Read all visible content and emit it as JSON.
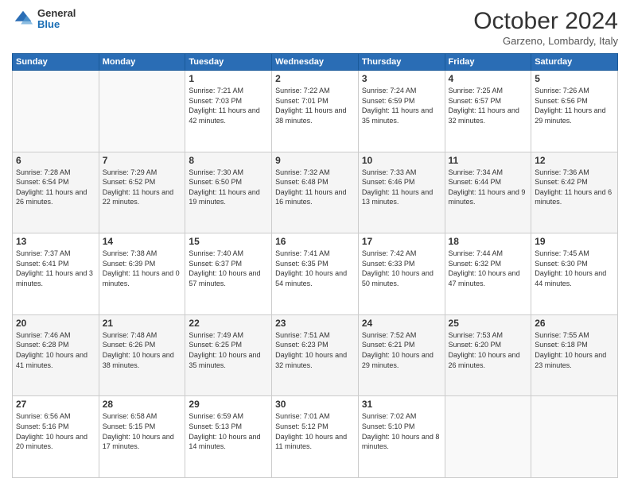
{
  "header": {
    "logo_general": "General",
    "logo_blue": "Blue",
    "month_title": "October 2024",
    "location": "Garzeno, Lombardy, Italy"
  },
  "weekdays": [
    "Sunday",
    "Monday",
    "Tuesday",
    "Wednesday",
    "Thursday",
    "Friday",
    "Saturday"
  ],
  "weeks": [
    [
      {
        "day": "",
        "sunrise": "",
        "sunset": "",
        "daylight": ""
      },
      {
        "day": "",
        "sunrise": "",
        "sunset": "",
        "daylight": ""
      },
      {
        "day": "1",
        "sunrise": "Sunrise: 7:21 AM",
        "sunset": "Sunset: 7:03 PM",
        "daylight": "Daylight: 11 hours and 42 minutes."
      },
      {
        "day": "2",
        "sunrise": "Sunrise: 7:22 AM",
        "sunset": "Sunset: 7:01 PM",
        "daylight": "Daylight: 11 hours and 38 minutes."
      },
      {
        "day": "3",
        "sunrise": "Sunrise: 7:24 AM",
        "sunset": "Sunset: 6:59 PM",
        "daylight": "Daylight: 11 hours and 35 minutes."
      },
      {
        "day": "4",
        "sunrise": "Sunrise: 7:25 AM",
        "sunset": "Sunset: 6:57 PM",
        "daylight": "Daylight: 11 hours and 32 minutes."
      },
      {
        "day": "5",
        "sunrise": "Sunrise: 7:26 AM",
        "sunset": "Sunset: 6:56 PM",
        "daylight": "Daylight: 11 hours and 29 minutes."
      }
    ],
    [
      {
        "day": "6",
        "sunrise": "Sunrise: 7:28 AM",
        "sunset": "Sunset: 6:54 PM",
        "daylight": "Daylight: 11 hours and 26 minutes."
      },
      {
        "day": "7",
        "sunrise": "Sunrise: 7:29 AM",
        "sunset": "Sunset: 6:52 PM",
        "daylight": "Daylight: 11 hours and 22 minutes."
      },
      {
        "day": "8",
        "sunrise": "Sunrise: 7:30 AM",
        "sunset": "Sunset: 6:50 PM",
        "daylight": "Daylight: 11 hours and 19 minutes."
      },
      {
        "day": "9",
        "sunrise": "Sunrise: 7:32 AM",
        "sunset": "Sunset: 6:48 PM",
        "daylight": "Daylight: 11 hours and 16 minutes."
      },
      {
        "day": "10",
        "sunrise": "Sunrise: 7:33 AM",
        "sunset": "Sunset: 6:46 PM",
        "daylight": "Daylight: 11 hours and 13 minutes."
      },
      {
        "day": "11",
        "sunrise": "Sunrise: 7:34 AM",
        "sunset": "Sunset: 6:44 PM",
        "daylight": "Daylight: 11 hours and 9 minutes."
      },
      {
        "day": "12",
        "sunrise": "Sunrise: 7:36 AM",
        "sunset": "Sunset: 6:42 PM",
        "daylight": "Daylight: 11 hours and 6 minutes."
      }
    ],
    [
      {
        "day": "13",
        "sunrise": "Sunrise: 7:37 AM",
        "sunset": "Sunset: 6:41 PM",
        "daylight": "Daylight: 11 hours and 3 minutes."
      },
      {
        "day": "14",
        "sunrise": "Sunrise: 7:38 AM",
        "sunset": "Sunset: 6:39 PM",
        "daylight": "Daylight: 11 hours and 0 minutes."
      },
      {
        "day": "15",
        "sunrise": "Sunrise: 7:40 AM",
        "sunset": "Sunset: 6:37 PM",
        "daylight": "Daylight: 10 hours and 57 minutes."
      },
      {
        "day": "16",
        "sunrise": "Sunrise: 7:41 AM",
        "sunset": "Sunset: 6:35 PM",
        "daylight": "Daylight: 10 hours and 54 minutes."
      },
      {
        "day": "17",
        "sunrise": "Sunrise: 7:42 AM",
        "sunset": "Sunset: 6:33 PM",
        "daylight": "Daylight: 10 hours and 50 minutes."
      },
      {
        "day": "18",
        "sunrise": "Sunrise: 7:44 AM",
        "sunset": "Sunset: 6:32 PM",
        "daylight": "Daylight: 10 hours and 47 minutes."
      },
      {
        "day": "19",
        "sunrise": "Sunrise: 7:45 AM",
        "sunset": "Sunset: 6:30 PM",
        "daylight": "Daylight: 10 hours and 44 minutes."
      }
    ],
    [
      {
        "day": "20",
        "sunrise": "Sunrise: 7:46 AM",
        "sunset": "Sunset: 6:28 PM",
        "daylight": "Daylight: 10 hours and 41 minutes."
      },
      {
        "day": "21",
        "sunrise": "Sunrise: 7:48 AM",
        "sunset": "Sunset: 6:26 PM",
        "daylight": "Daylight: 10 hours and 38 minutes."
      },
      {
        "day": "22",
        "sunrise": "Sunrise: 7:49 AM",
        "sunset": "Sunset: 6:25 PM",
        "daylight": "Daylight: 10 hours and 35 minutes."
      },
      {
        "day": "23",
        "sunrise": "Sunrise: 7:51 AM",
        "sunset": "Sunset: 6:23 PM",
        "daylight": "Daylight: 10 hours and 32 minutes."
      },
      {
        "day": "24",
        "sunrise": "Sunrise: 7:52 AM",
        "sunset": "Sunset: 6:21 PM",
        "daylight": "Daylight: 10 hours and 29 minutes."
      },
      {
        "day": "25",
        "sunrise": "Sunrise: 7:53 AM",
        "sunset": "Sunset: 6:20 PM",
        "daylight": "Daylight: 10 hours and 26 minutes."
      },
      {
        "day": "26",
        "sunrise": "Sunrise: 7:55 AM",
        "sunset": "Sunset: 6:18 PM",
        "daylight": "Daylight: 10 hours and 23 minutes."
      }
    ],
    [
      {
        "day": "27",
        "sunrise": "Sunrise: 6:56 AM",
        "sunset": "Sunset: 5:16 PM",
        "daylight": "Daylight: 10 hours and 20 minutes."
      },
      {
        "day": "28",
        "sunrise": "Sunrise: 6:58 AM",
        "sunset": "Sunset: 5:15 PM",
        "daylight": "Daylight: 10 hours and 17 minutes."
      },
      {
        "day": "29",
        "sunrise": "Sunrise: 6:59 AM",
        "sunset": "Sunset: 5:13 PM",
        "daylight": "Daylight: 10 hours and 14 minutes."
      },
      {
        "day": "30",
        "sunrise": "Sunrise: 7:01 AM",
        "sunset": "Sunset: 5:12 PM",
        "daylight": "Daylight: 10 hours and 11 minutes."
      },
      {
        "day": "31",
        "sunrise": "Sunrise: 7:02 AM",
        "sunset": "Sunset: 5:10 PM",
        "daylight": "Daylight: 10 hours and 8 minutes."
      },
      {
        "day": "",
        "sunrise": "",
        "sunset": "",
        "daylight": ""
      },
      {
        "day": "",
        "sunrise": "",
        "sunset": "",
        "daylight": ""
      }
    ]
  ]
}
